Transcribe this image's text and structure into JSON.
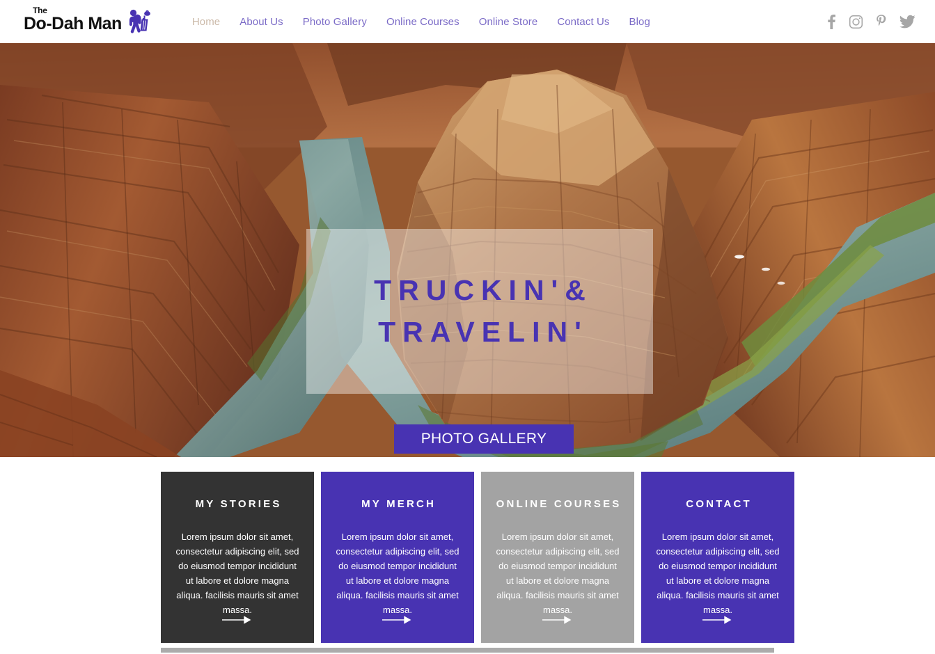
{
  "header": {
    "logo": {
      "the": "The",
      "name": "Do-Dah Man",
      "mark_icon": "traveler-with-luggage-icon"
    },
    "nav": [
      {
        "label": "Home",
        "active": true
      },
      {
        "label": "About Us",
        "active": false
      },
      {
        "label": "Photo Gallery",
        "active": false
      },
      {
        "label": "Online Courses",
        "active": false
      },
      {
        "label": "Online Store",
        "active": false
      },
      {
        "label": "Contact Us",
        "active": false
      },
      {
        "label": "Blog",
        "active": false
      }
    ],
    "social": [
      {
        "icon": "facebook-icon",
        "label": "Facebook"
      },
      {
        "icon": "instagram-icon",
        "label": "Instagram"
      },
      {
        "icon": "pinterest-icon",
        "label": "Pinterest"
      },
      {
        "icon": "twitter-icon",
        "label": "Twitter"
      }
    ]
  },
  "hero": {
    "title_line1": "TRUCKIN'&",
    "title_line2": "TRAVELIN'",
    "button_label": "PHOTO GALLERY",
    "background_description": "Aerial photo of Horseshoe Bend canyon with the Colorado River"
  },
  "cards": [
    {
      "title": "MY STORIES",
      "body": "Lorem ipsum dolor sit amet, consectetur adipiscing elit, sed do eiusmod tempor incididunt ut labore et dolore magna aliqua. facilisis mauris sit amet massa.",
      "bg": "#333333",
      "arrow_icon": "arrow-right-icon"
    },
    {
      "title": "MY MERCH",
      "body": "Lorem ipsum dolor sit amet, consectetur adipiscing elit, sed do eiusmod tempor incididunt ut labore et dolore magna aliqua. facilisis mauris sit amet massa.",
      "bg": "#4833b2",
      "arrow_icon": "arrow-right-icon"
    },
    {
      "title": "ONLINE COURSES",
      "body": "Lorem ipsum dolor sit amet, consectetur adipiscing elit, sed do eiusmod tempor incididunt ut labore et dolore magna aliqua. facilisis mauris sit amet massa.",
      "bg": "#a3a3a3",
      "arrow_icon": "arrow-right-icon"
    },
    {
      "title": "CONTACT",
      "body": "Lorem ipsum dolor sit amet, consectetur adipiscing elit, sed do eiusmod tempor incididunt ut labore et dolore magna aliqua. facilisis mauris sit amet massa.",
      "bg": "#4833b2",
      "arrow_icon": "arrow-right-icon"
    }
  ],
  "colors": {
    "accent_purple": "#4833b2",
    "nav_link": "#7b6bc7",
    "nav_active": "#cbb9a8",
    "dark_card": "#333333",
    "gray_card": "#a3a3a3",
    "footer_bar": "#ababab",
    "social_icon": "#a6a6a6"
  }
}
